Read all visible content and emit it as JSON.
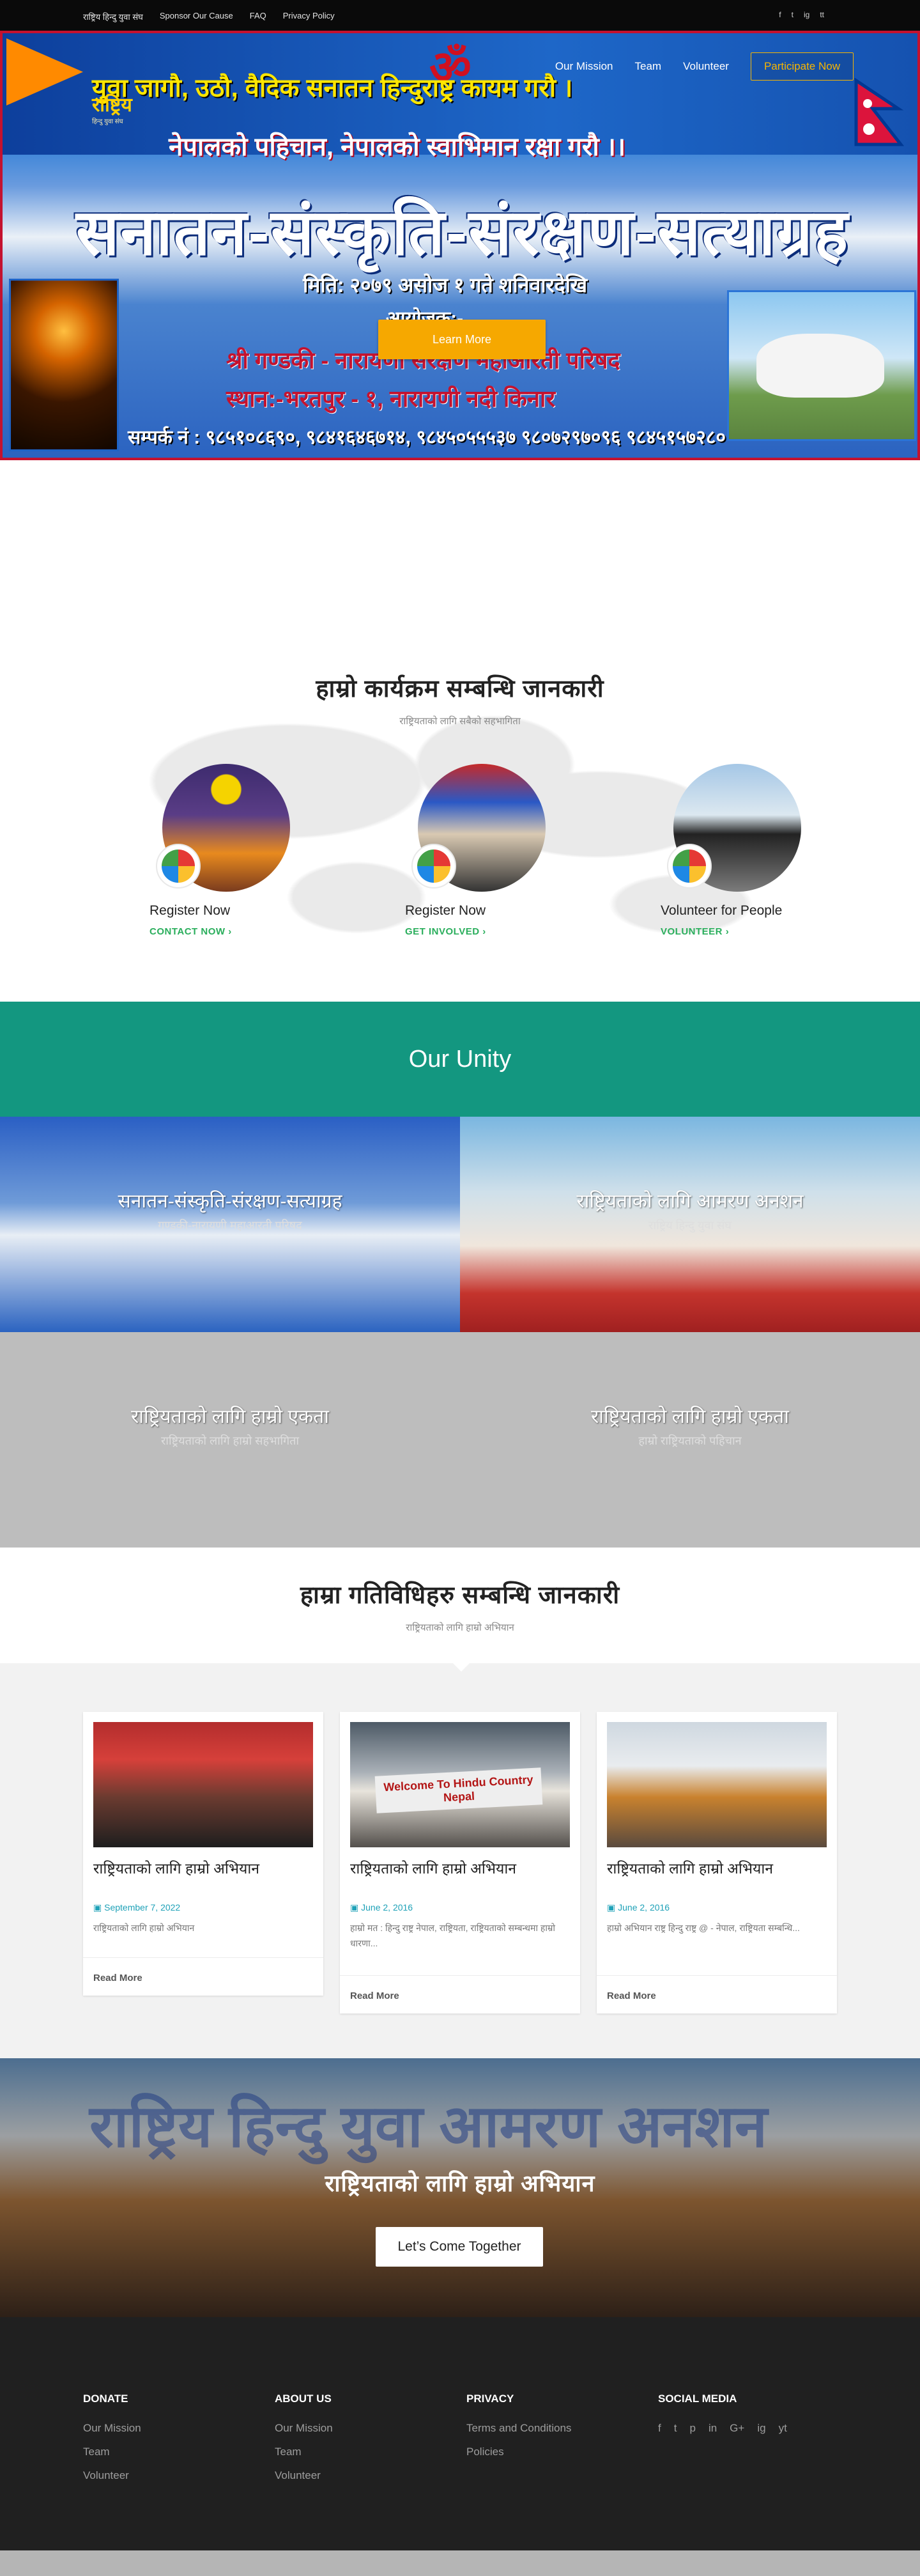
{
  "topbar": {
    "links": [
      "राष्ट्रिय हिन्दु युवा संघ",
      "Sponsor Our Cause",
      "FAQ",
      "Privacy Policy"
    ],
    "social": [
      "f",
      "t",
      "ig",
      "tt"
    ]
  },
  "nav": {
    "items": [
      "Our Mission",
      "Team",
      "Volunteer"
    ],
    "cta": "Participate Now"
  },
  "logo": {
    "title": "राष्ट्रिय",
    "subtitle": "हिन्दु युवा संघ"
  },
  "hero": {
    "om": "ॐ",
    "line1": "युवा जागौ, उठौ, वैदिक सनातन हिन्दुराष्ट्र कायम गरौ ।",
    "line2": "नेपालको पहिचान, नेपालको स्वाभिमान रक्षा गरौ ।।",
    "headline": "सनातन-संस्कृति-संरक्षण-सत्याग्रह",
    "date": "मिति: २०७९ असोज १ गते शनिवारदेखि",
    "organizer_label": "आयोजक:-",
    "organizer": "श्री गण्डकी - नारायणी संरक्षण महाआरती परिषद",
    "place": "स्थान:-भरतपुर - १, नारायणी नदी किनार",
    "contact": "सम्पर्क नं : ९८५१०८६९०, ९८४१६४६७१४, ९८४५०५५५३७ ९८०७२९७०९६ ९८४५१५७२८०",
    "button": "Learn More"
  },
  "mission": {
    "title": "हाम्रो कार्यक्रम सम्बन्धि जानकारी",
    "subtitle": "राष्ट्रियताको लागि सबैको सहभागिता",
    "features": [
      {
        "name": "Register Now",
        "link": "CONTACT NOW"
      },
      {
        "name": "Register Now",
        "link": "GET INVOLVED"
      },
      {
        "name": "Volunteer for People",
        "link": "VOLUNTEER"
      }
    ]
  },
  "unity": {
    "title": "Our Unity"
  },
  "tiles": [
    {
      "title": "सनातन-संस्कृति-संरक्षण-सत्याग्रह",
      "subtitle": "गण्डकी-नारायणी महाआरती परिषद"
    },
    {
      "title": "राष्ट्रियताको लागि आमरण अनशन",
      "subtitle": "राष्ट्रिय हिन्दु युवा संघ"
    },
    {
      "title": "राष्ट्रियताको लागि हाम्रो एकता",
      "subtitle": "राष्ट्रियताको लागि हाम्रो सहभागिता"
    },
    {
      "title": "राष्ट्रियताको लागि हाम्रो एकता",
      "subtitle": "हाम्रो राष्ट्रियताको पहिचान"
    }
  ],
  "blog": {
    "title": "हाम्रा गतिविधिहरु सम्बन्धि जानकारी",
    "subtitle": "राष्ट्रियताको लागि हाम्रो अभियान",
    "posts": [
      {
        "title": "राष्ट्रियताको लागि हाम्रो अभियान",
        "date": "September 7, 2022",
        "excerpt": "राष्ट्रियताको लागि हाम्रो अभियान",
        "read_more": "Read More"
      },
      {
        "title": "राष्ट्रियताको लागि हाम्रो अभियान",
        "date": "June 2, 2016",
        "excerpt": "हाम्रो मत : हिन्दु राष्ट्र नेपाल, राष्ट्रियता, राष्ट्रियताको सम्बन्धमा हाम्रो धारणा...",
        "read_more": "Read More"
      },
      {
        "title": "राष्ट्रियताको लागि हाम्रो अभियान",
        "date": "June 2, 2016",
        "excerpt": "हाम्रो अभियान राष्ट्र हिन्दु राष्ट्र @ - नेपाल, राष्ट्रियता सम्बन्धि...",
        "read_more": "Read More"
      }
    ],
    "welcome_sign": "Welcome To Hindu Country Nepal"
  },
  "join": {
    "bg_text": "राष्ट्रिय हिन्दु युवा आमरण अनशन",
    "title": "राष्ट्रियताको लागि हाम्रो अभियान",
    "button": "Let’s Come Together"
  },
  "footer": {
    "columns": [
      {
        "heading": "DONATE",
        "links": [
          "Our Mission",
          "Team",
          "Volunteer"
        ]
      },
      {
        "heading": "ABOUT US",
        "links": [
          "Our Mission",
          "Team",
          "Volunteer"
        ]
      },
      {
        "heading": "PRIVACY",
        "links": [
          "Terms and Conditions",
          "Policies"
        ]
      }
    ],
    "social_heading": "SOCIAL MEDIA",
    "social_icons": [
      "f",
      "t",
      "p",
      "in",
      "G+",
      "ig",
      "yt"
    ]
  },
  "colors": {
    "accent": "#f6a800",
    "teal": "#139780",
    "green": "#2aae5c",
    "footer": "#202020"
  }
}
